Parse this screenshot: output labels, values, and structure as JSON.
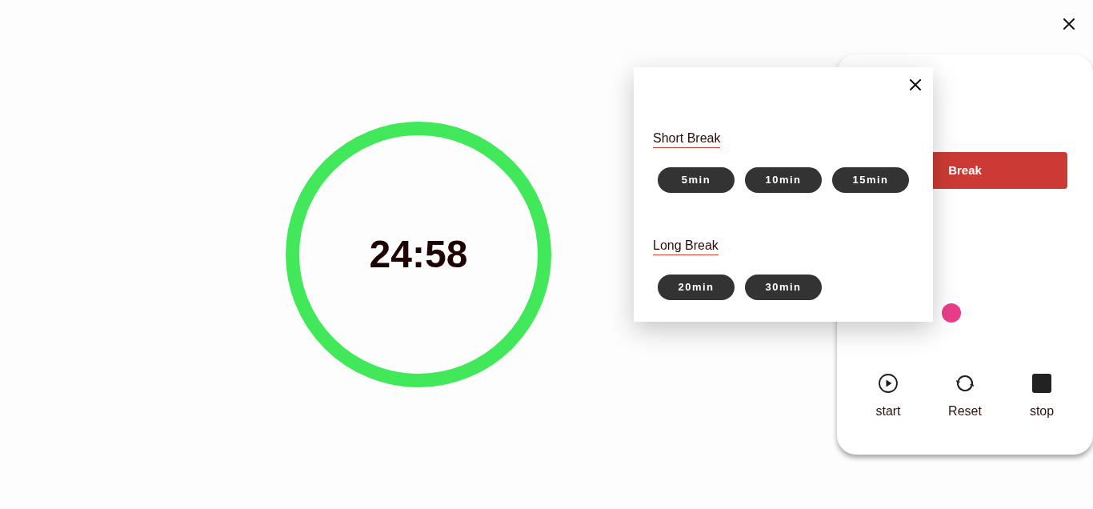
{
  "timer": {
    "time": "24:58"
  },
  "panel": {
    "mode_button": {
      "label": "Break"
    },
    "color_options": [
      {
        "color": "#e83e8c"
      }
    ],
    "controls": [
      {
        "kind": "start",
        "label": "start"
      },
      {
        "kind": "reset",
        "label": "Reset"
      },
      {
        "kind": "stop",
        "label": "stop"
      }
    ]
  },
  "break_popup": {
    "sections": [
      {
        "title": "Short Break",
        "options": [
          "5min",
          "10min",
          "15min"
        ]
      },
      {
        "title": "Long Break",
        "options": [
          "20min",
          "30min"
        ]
      }
    ]
  }
}
